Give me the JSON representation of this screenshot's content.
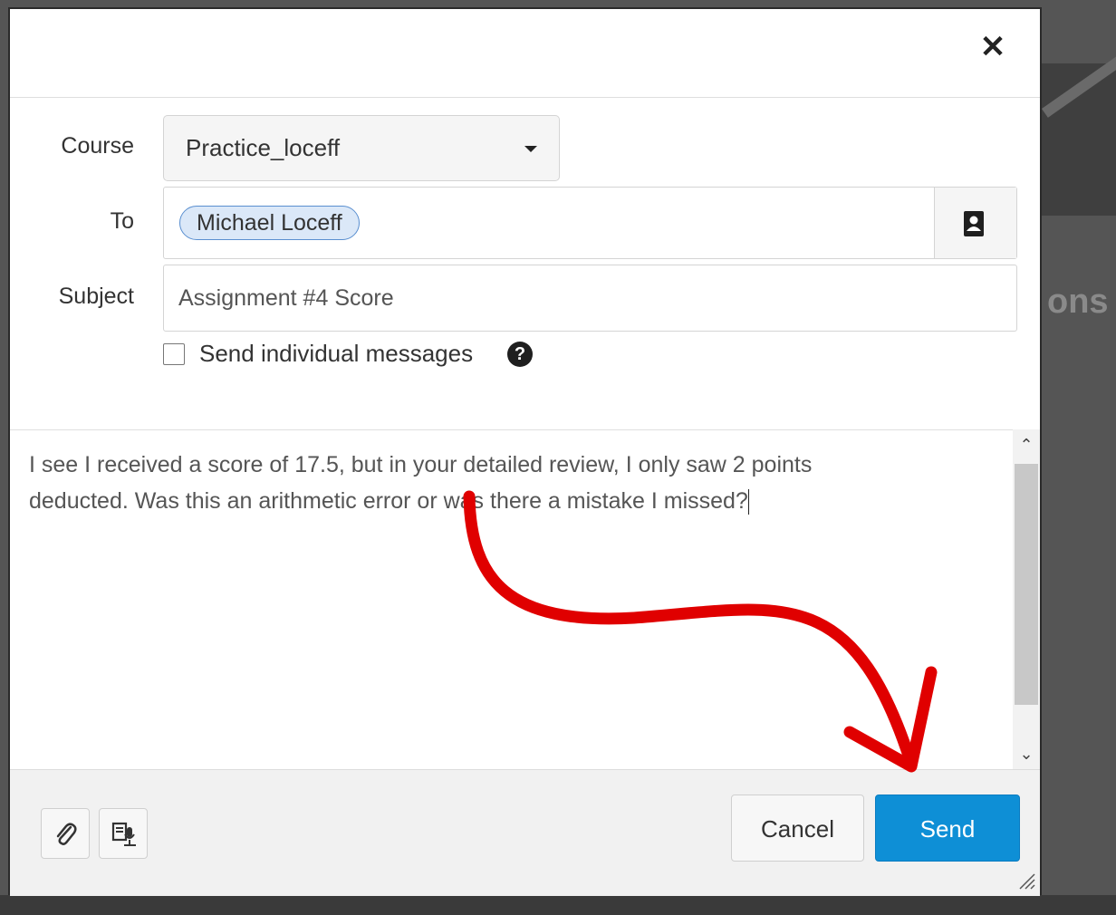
{
  "background": {
    "peek_text": "ons"
  },
  "dialog": {
    "close_glyph": "✕",
    "labels": {
      "course": "Course",
      "to": "To",
      "subject": "Subject"
    },
    "course_select": {
      "value": "Practice_loceff"
    },
    "to_field": {
      "recipients": [
        "Michael Loceff"
      ],
      "address_book_icon": "address-book-icon"
    },
    "subject_field": {
      "value": "Assignment #4 Score"
    },
    "individual_messages": {
      "label": "Send individual messages",
      "checked": false,
      "help_glyph": "?"
    },
    "message_body": {
      "line1": "I see I received a score of 17.5, but in your detailed review, I only saw 2 points",
      "line2": "deducted.  Was this an arithmetic error or was there a mistake I missed?"
    },
    "scrollbar": {
      "up_glyph": "⌃",
      "down_glyph": "⌄"
    },
    "footer": {
      "attach_icon": "paperclip-icon",
      "media_icon": "media-record-icon",
      "cancel_label": "Cancel",
      "send_label": "Send"
    }
  },
  "colors": {
    "send_button": "#0e8fd6",
    "annotation_arrow": "#e00000",
    "recipient_pill": "#dbe8f8"
  }
}
